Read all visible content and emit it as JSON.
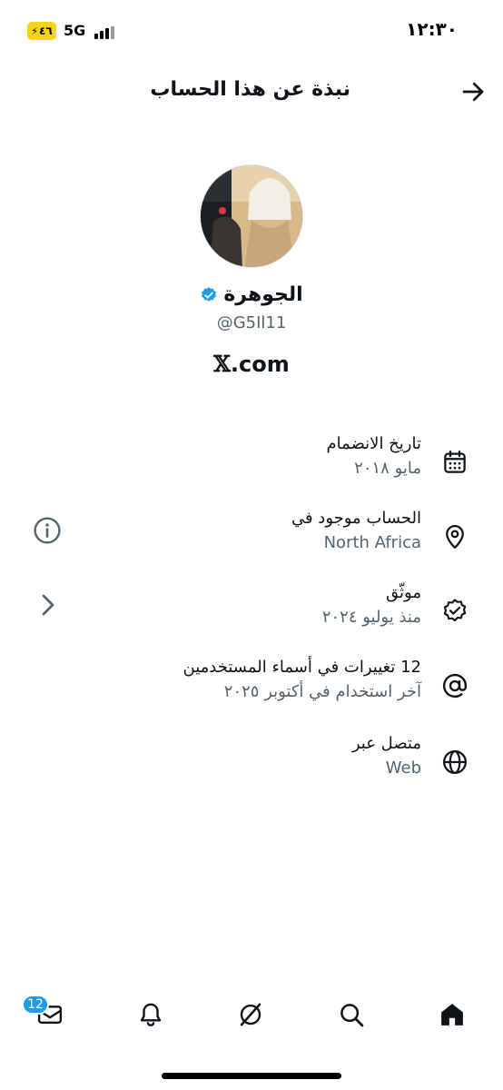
{
  "status": {
    "time": "١٢:٣٠",
    "battery": "٤٦",
    "network": "5G"
  },
  "header": {
    "title": "نبذة عن هذا الحساب"
  },
  "profile": {
    "name": "الجوهرة",
    "handle": "@G5Il11",
    "site": ".com",
    "site_mark": "𝕏"
  },
  "rows": [
    {
      "title": "تاريخ الانضمام",
      "sub": "مايو ٢٠١٨",
      "icon": "calendar-icon"
    },
    {
      "title": "الحساب موجود في",
      "sub": "North Africa",
      "icon": "location-pin-icon"
    },
    {
      "title": "موثّق",
      "sub": "منذ يوليو ٢٠٢٤",
      "icon": "verified-badge-icon"
    },
    {
      "title": "12 تغييرات في أسماء المستخدمين",
      "sub": "آخر استخدام في أكتوبر ٢٠٢٥",
      "icon": "at-sign-icon"
    },
    {
      "title": "متصل عبر",
      "sub": "Web",
      "icon": "globe-icon"
    }
  ],
  "nav": {
    "messages_badge": "12"
  },
  "colors": {
    "accent": "#1d9bf0",
    "text": "#0f1419",
    "secondary": "#536471",
    "battery": "#f7d31b"
  }
}
